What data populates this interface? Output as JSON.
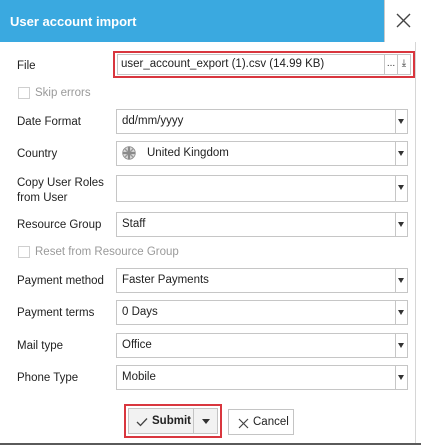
{
  "dialog": {
    "title": "User account import"
  },
  "file": {
    "label": "File",
    "value": "user_account_export (1).csv (14.99 KB)",
    "browse_glyph": "...",
    "download_glyph": "⤓"
  },
  "skip_errors": {
    "label": "Skip errors",
    "checked": false
  },
  "date_format": {
    "label": "Date Format",
    "value": "dd/mm/yyyy"
  },
  "country": {
    "label": "Country",
    "value": "United Kingdom",
    "icon": "uk-flag-icon"
  },
  "copy_roles": {
    "label_line1": "Copy User Roles",
    "label_line2": "from User",
    "value": ""
  },
  "resource_group": {
    "label": "Resource Group",
    "value": "Staff"
  },
  "reset_resource_group": {
    "label": "Reset from Resource Group",
    "checked": false
  },
  "payment_method": {
    "label": "Payment method",
    "value": "Faster Payments"
  },
  "payment_terms": {
    "label": "Payment terms",
    "value": "0 Days"
  },
  "mail_type": {
    "label": "Mail type",
    "value": "Office"
  },
  "phone_type": {
    "label": "Phone Type",
    "value": "Mobile"
  },
  "actions": {
    "submit_label": "Submit",
    "cancel_label": "Cancel"
  },
  "colors": {
    "title_bar": "#3aa9e0",
    "highlight": "#d9363e"
  }
}
